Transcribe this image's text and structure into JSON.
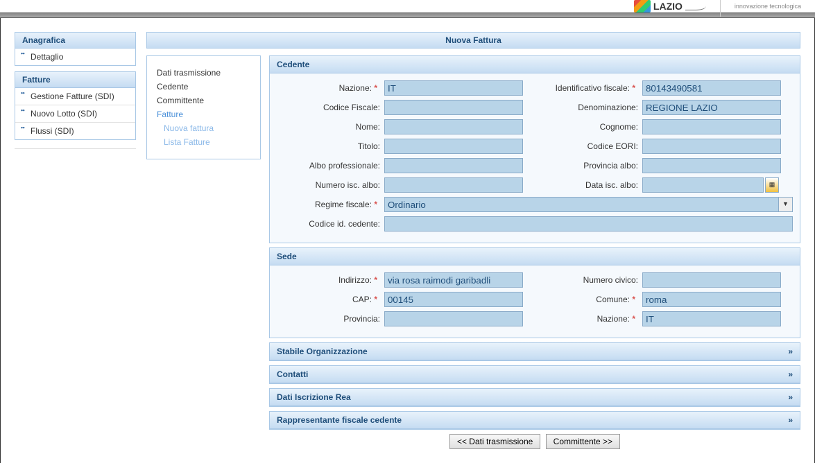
{
  "header": {
    "logo_text": "LAZIO",
    "tech_text": "innovazione tecnologica"
  },
  "sidebar": {
    "groups": [
      {
        "title": "Anagrafica",
        "items": [
          "Dettaglio"
        ]
      },
      {
        "title": "Fatture",
        "items": [
          "Gestione Fatture (SDI)",
          "Nuovo Lotto (SDI)",
          "Flussi (SDI)"
        ]
      }
    ]
  },
  "panel_title": "Nuova Fattura",
  "steps": {
    "dati_trasmissione": "Dati trasmissione",
    "cedente": "Cedente",
    "committente": "Committente",
    "fatture": "Fatture",
    "nuova_fattura": "Nuova fattura",
    "lista_fatture": "Lista Fatture"
  },
  "sections": {
    "cedente": {
      "title": "Cedente",
      "fields": {
        "nazione_label": "Nazione:",
        "nazione_value": "IT",
        "id_fiscale_label": "Identificativo fiscale:",
        "id_fiscale_value": "80143490581",
        "codice_fiscale_label": "Codice Fiscale:",
        "codice_fiscale_value": "",
        "denominazione_label": "Denominazione:",
        "denominazione_value": "REGIONE LAZIO",
        "nome_label": "Nome:",
        "nome_value": "",
        "cognome_label": "Cognome:",
        "cognome_value": "",
        "titolo_label": "Titolo:",
        "titolo_value": "",
        "codice_eori_label": "Codice EORI:",
        "codice_eori_value": "",
        "albo_prof_label": "Albo professionale:",
        "albo_prof_value": "",
        "prov_albo_label": "Provincia albo:",
        "prov_albo_value": "",
        "num_isc_albo_label": "Numero isc. albo:",
        "num_isc_albo_value": "",
        "data_isc_albo_label": "Data isc. albo:",
        "data_isc_albo_value": "",
        "regime_fiscale_label": "Regime fiscale:",
        "regime_fiscale_value": "Ordinario",
        "codice_id_cedente_label": "Codice id. cedente:",
        "codice_id_cedente_value": ""
      }
    },
    "sede": {
      "title": "Sede",
      "fields": {
        "indirizzo_label": "Indirizzo:",
        "indirizzo_value": "via rosa raimodi garibadli",
        "numero_civico_label": "Numero civico:",
        "numero_civico_value": "",
        "cap_label": "CAP:",
        "cap_value": "00145",
        "comune_label": "Comune:",
        "comune_value": "roma",
        "provincia_label": "Provincia:",
        "provincia_value": "",
        "nazione_label": "Nazione:",
        "nazione_value": "IT"
      }
    },
    "stabile_org": {
      "title": "Stabile Organizzazione"
    },
    "contatti": {
      "title": "Contatti"
    },
    "dati_iscr_rea": {
      "title": "Dati Iscrizione Rea"
    },
    "rappresentante": {
      "title": "Rappresentante fiscale cedente"
    }
  },
  "nav": {
    "prev": "<< Dati trasmissione",
    "next": "Committente >>"
  },
  "chevron": "»"
}
